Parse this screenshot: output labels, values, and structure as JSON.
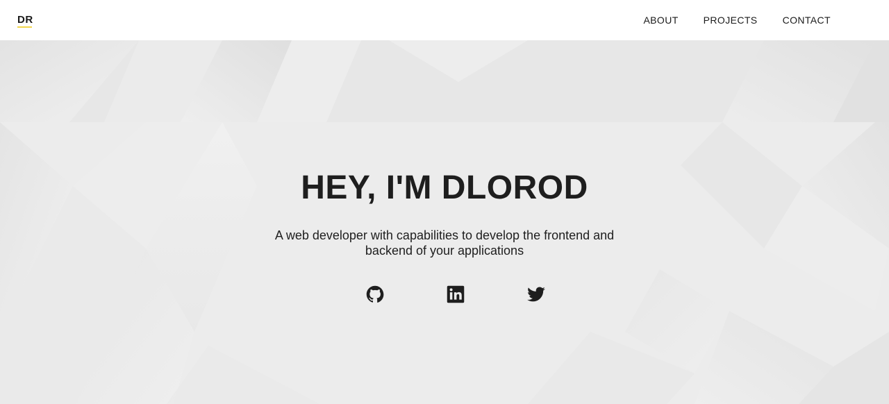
{
  "header": {
    "logo": "DR",
    "nav": [
      {
        "label": "ABOUT"
      },
      {
        "label": "PROJECTS"
      },
      {
        "label": "CONTACT"
      }
    ]
  },
  "hero": {
    "title": "HEY, I'M DLOROD",
    "subtitle_line1": "A web developer with capabilities to develop the frontend and",
    "subtitle_line2": "backend of your applications",
    "socials": [
      {
        "icon": "github-icon"
      },
      {
        "icon": "linkedin-icon"
      },
      {
        "icon": "twitter-icon"
      }
    ]
  },
  "colors": {
    "text": "#1e1e1e",
    "header_bg": "#ffffff",
    "hero_bg": "#ececec",
    "logo_accent": "#f2d54a"
  }
}
